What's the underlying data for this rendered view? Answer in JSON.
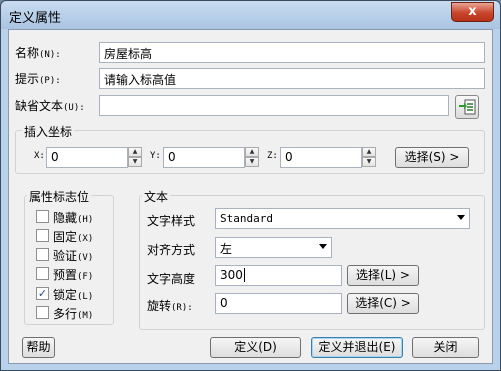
{
  "dialog": {
    "title": "定义属性",
    "close_label": "x"
  },
  "fields": {
    "name_label": "名称",
    "name_key": "(N):",
    "name_value": "房屋标高",
    "prompt_label": "提示",
    "prompt_key": "(P):",
    "prompt_value": "请输入标高值",
    "default_label": "缺省文本",
    "default_key": "(U):",
    "default_value": ""
  },
  "insert": {
    "group_title": "插入坐标",
    "x_label": "X:",
    "x_value": "0",
    "y_label": "Y:",
    "y_value": "0",
    "z_label": "Z:",
    "z_value": "0",
    "select_label": "选择(S) >"
  },
  "flags": {
    "group_title": "属性标志位",
    "items": [
      {
        "label": "隐藏",
        "key": "(H)",
        "checked": false
      },
      {
        "label": "固定",
        "key": "(X)",
        "checked": false
      },
      {
        "label": "验证",
        "key": "(V)",
        "checked": false
      },
      {
        "label": "预置",
        "key": "(F)",
        "checked": false
      },
      {
        "label": "锁定",
        "key": "(L)",
        "checked": true
      },
      {
        "label": "多行",
        "key": "(M)",
        "checked": false
      }
    ]
  },
  "text": {
    "group_title": "文本",
    "style_label": "文字样式",
    "style_value": "Standard",
    "align_label": "对齐方式",
    "align_value": "左",
    "height_label": "文字高度",
    "height_value": "300",
    "height_select": "选择(L) >",
    "rotation_label": "旋转",
    "rotation_key": "(R):",
    "rotation_value": "0",
    "rotation_select": "选择(C) >"
  },
  "buttons": {
    "help": "帮助",
    "define": "定义(D)",
    "define_exit": "定义并退出(E)",
    "close": "关闭"
  }
}
